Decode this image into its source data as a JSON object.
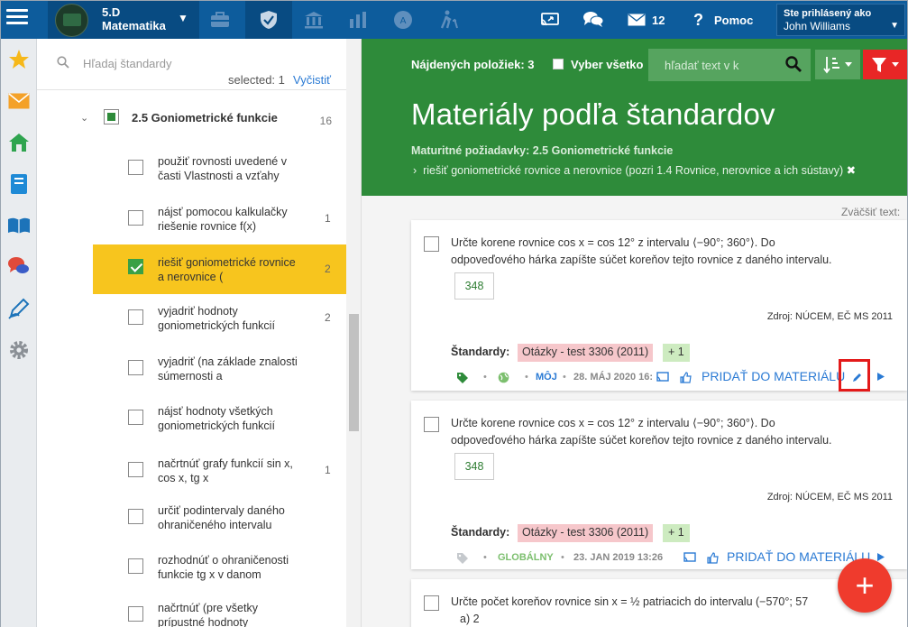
{
  "topbar": {
    "class_line1": "5.D",
    "class_line2": "Matematika",
    "notifications_count": "12",
    "help_label": "Pomoc",
    "user_label": "Ste prihlásený ako",
    "user_name": "John Williams",
    "icons": [
      "menu-icon",
      "briefcase-icon",
      "shield-icon",
      "institution-icon",
      "bar-chart-icon",
      "badge-icon",
      "walking-icon",
      "screen-share-icon",
      "chat-icon",
      "mail-icon",
      "question-icon"
    ]
  },
  "rail": {
    "icons": [
      "star-icon",
      "mail-icon",
      "home-icon",
      "notebook-icon",
      "book-icon",
      "chat-bubbles-icon",
      "pen-icon",
      "gear-icon"
    ]
  },
  "sidebar": {
    "search_placeholder": "Hľadaj štandardy",
    "selected_text": "selected: 1",
    "clear_label": "Vyčistiť",
    "group": {
      "label": "2.5 Goniometrické funkcie",
      "count": "16"
    },
    "items": [
      {
        "text": "použiť rovnosti uvedené v časti Vlastnosti a vzťahy",
        "count": "",
        "selected": false
      },
      {
        "text": "nájsť pomocou kalkulačky riešenie rovnice f(x)",
        "count": "1",
        "selected": false
      },
      {
        "text": "riešiť goniometrické rovnice a nerovnice (",
        "count": "2",
        "selected": true
      },
      {
        "text": "vyjadriť hodnoty goniometrických funkcií",
        "count": "2",
        "selected": false
      },
      {
        "text": "vyjadriť (na základe znalosti súmernosti a",
        "count": "",
        "selected": false
      },
      {
        "text": "nájsť hodnoty všetkých goniometrických funkcií",
        "count": "",
        "selected": false
      },
      {
        "text": "načrtnúť grafy funkcií sin x, cos x, tg x",
        "count": "1",
        "selected": false
      },
      {
        "text": "určiť podintervaly daného ohraničeného intervalu",
        "count": "",
        "selected": false
      },
      {
        "text": "rozhodnúť o ohraničenosti funkcie tg x v danom",
        "count": "",
        "selected": false
      },
      {
        "text": "načrtnúť (pre všetky prípustné hodnoty",
        "count": "",
        "selected": false
      }
    ]
  },
  "hero": {
    "found_label": "Nájdených položiek: 3",
    "select_all_label": "Vyber všetko",
    "search_placeholder": "hľadať text v k",
    "title": "Materiály podľa štandardov",
    "subtitle": "Maturitné požiadavky: 2.5 Goniometrické funkcie",
    "crumb": "riešiť goniometrické rovnice a nerovnice (pozri 1.4 Rovnice, nerovnice a ich sústavy)",
    "crumb_close": "✖"
  },
  "zoom_label": "Zväčšiť text:",
  "cards": [
    {
      "question_line1": "Určte korene rovnice cos x = cos 12° z intervalu ⟨−90°; 360°⟩. Do",
      "question_line2": "odpoveďového hárka zapíšte súčet koreňov tejto rovnice z daného intervalu.",
      "answer": "348",
      "source": "Zdroj: NÚCEM, EČ MS 2011",
      "standards_label": "Štandardy:",
      "standard_tag": "Otázky - test 3306 (2011)",
      "plus": "+ 1",
      "scope": "MÔJ",
      "date": "28. MÁJ 2020 16:",
      "add_label": "PRIDAŤ DO MATERIÁLU"
    },
    {
      "question_line1": "Určte korene rovnice cos x = cos 12° z intervalu ⟨−90°; 360°⟩. Do",
      "question_line2": "odpoveďového hárka zapíšte súčet koreňov tejto rovnice z daného intervalu.",
      "answer": "348",
      "source": "Zdroj: NÚCEM, EČ MS 2011",
      "standards_label": "Štandardy:",
      "standard_tag": "Otázky - test 3306 (2011)",
      "plus": "+ 1",
      "scope": "GLOBÁLNY",
      "date": "23. JAN 2019 13:26",
      "add_label": "PRIDAŤ DO MATERIÁLU"
    },
    {
      "question_line1": "Určte počet koreňov rovnice sin x = ½ patriacich do intervalu (−570°; 57",
      "question_line2": "a)  2"
    }
  ],
  "fab_label": "+",
  "colors": {
    "topbar": "#0d5c9c",
    "hero": "#2e8b3a",
    "selected_item": "#f7c51e",
    "accent_red": "#ef3b2d",
    "link_blue": "#2a7ad4"
  }
}
